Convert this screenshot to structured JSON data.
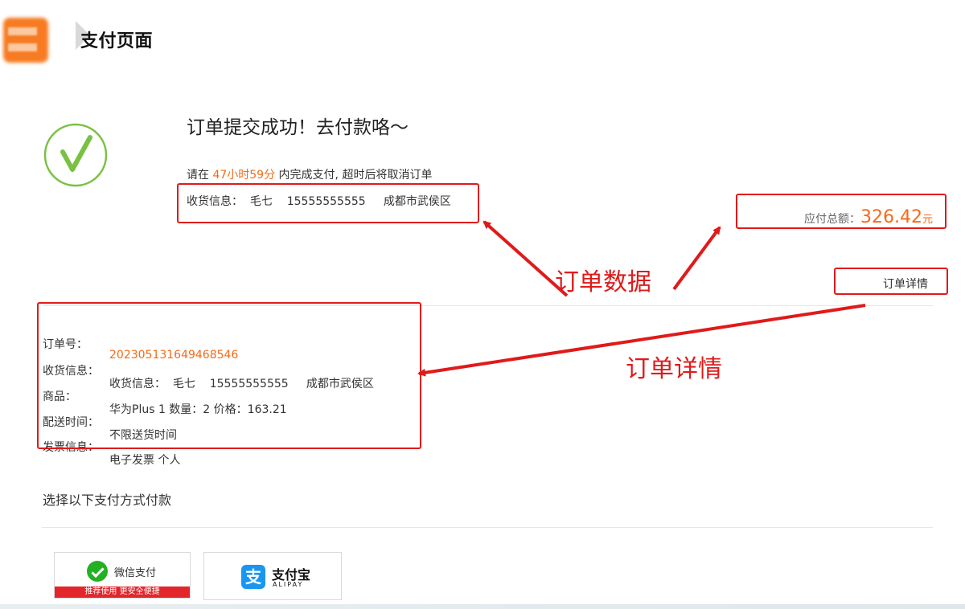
{
  "header": {
    "title": "支付页面"
  },
  "status": {
    "title": "订单提交成功！去付款咯～",
    "countdown_prefix": "请在",
    "countdown_time": "47小时59分",
    "countdown_suffix": "内完成支付, 超时后将取消订单",
    "shipping": "收货信息：  毛七    15555555555     成都市武侯区"
  },
  "summary": {
    "total_label": "应付总额：",
    "total_amount": "326.42",
    "total_unit": "元",
    "detail_button": "订单详情"
  },
  "details": {
    "rows": [
      {
        "label": "订单号：",
        "value": "202305131649468546"
      },
      {
        "label": "收货信息：",
        "value": "收货信息：  毛七    15555555555     成都市武侯区"
      },
      {
        "label": "商品：",
        "value": "华为Plus 1 数量：2 价格：163.21"
      },
      {
        "label": "配送时间：",
        "value": "不限送货时间"
      },
      {
        "label": "发票信息：",
        "value": "电子发票 个人"
      }
    ]
  },
  "payment": {
    "prompt": "选择以下支付方式付款",
    "wechat_label": "微信支付",
    "wechat_banner": "推荐使用 更安全便捷",
    "alipay_name": "支付宝",
    "alipay_sub": "ALIPAY"
  },
  "annotations": {
    "order_data": "订单数据",
    "order_details": "订单详情"
  },
  "colors": {
    "accent": "#f56a18",
    "annotation": "#e01a1a",
    "success": "#7ac143"
  }
}
